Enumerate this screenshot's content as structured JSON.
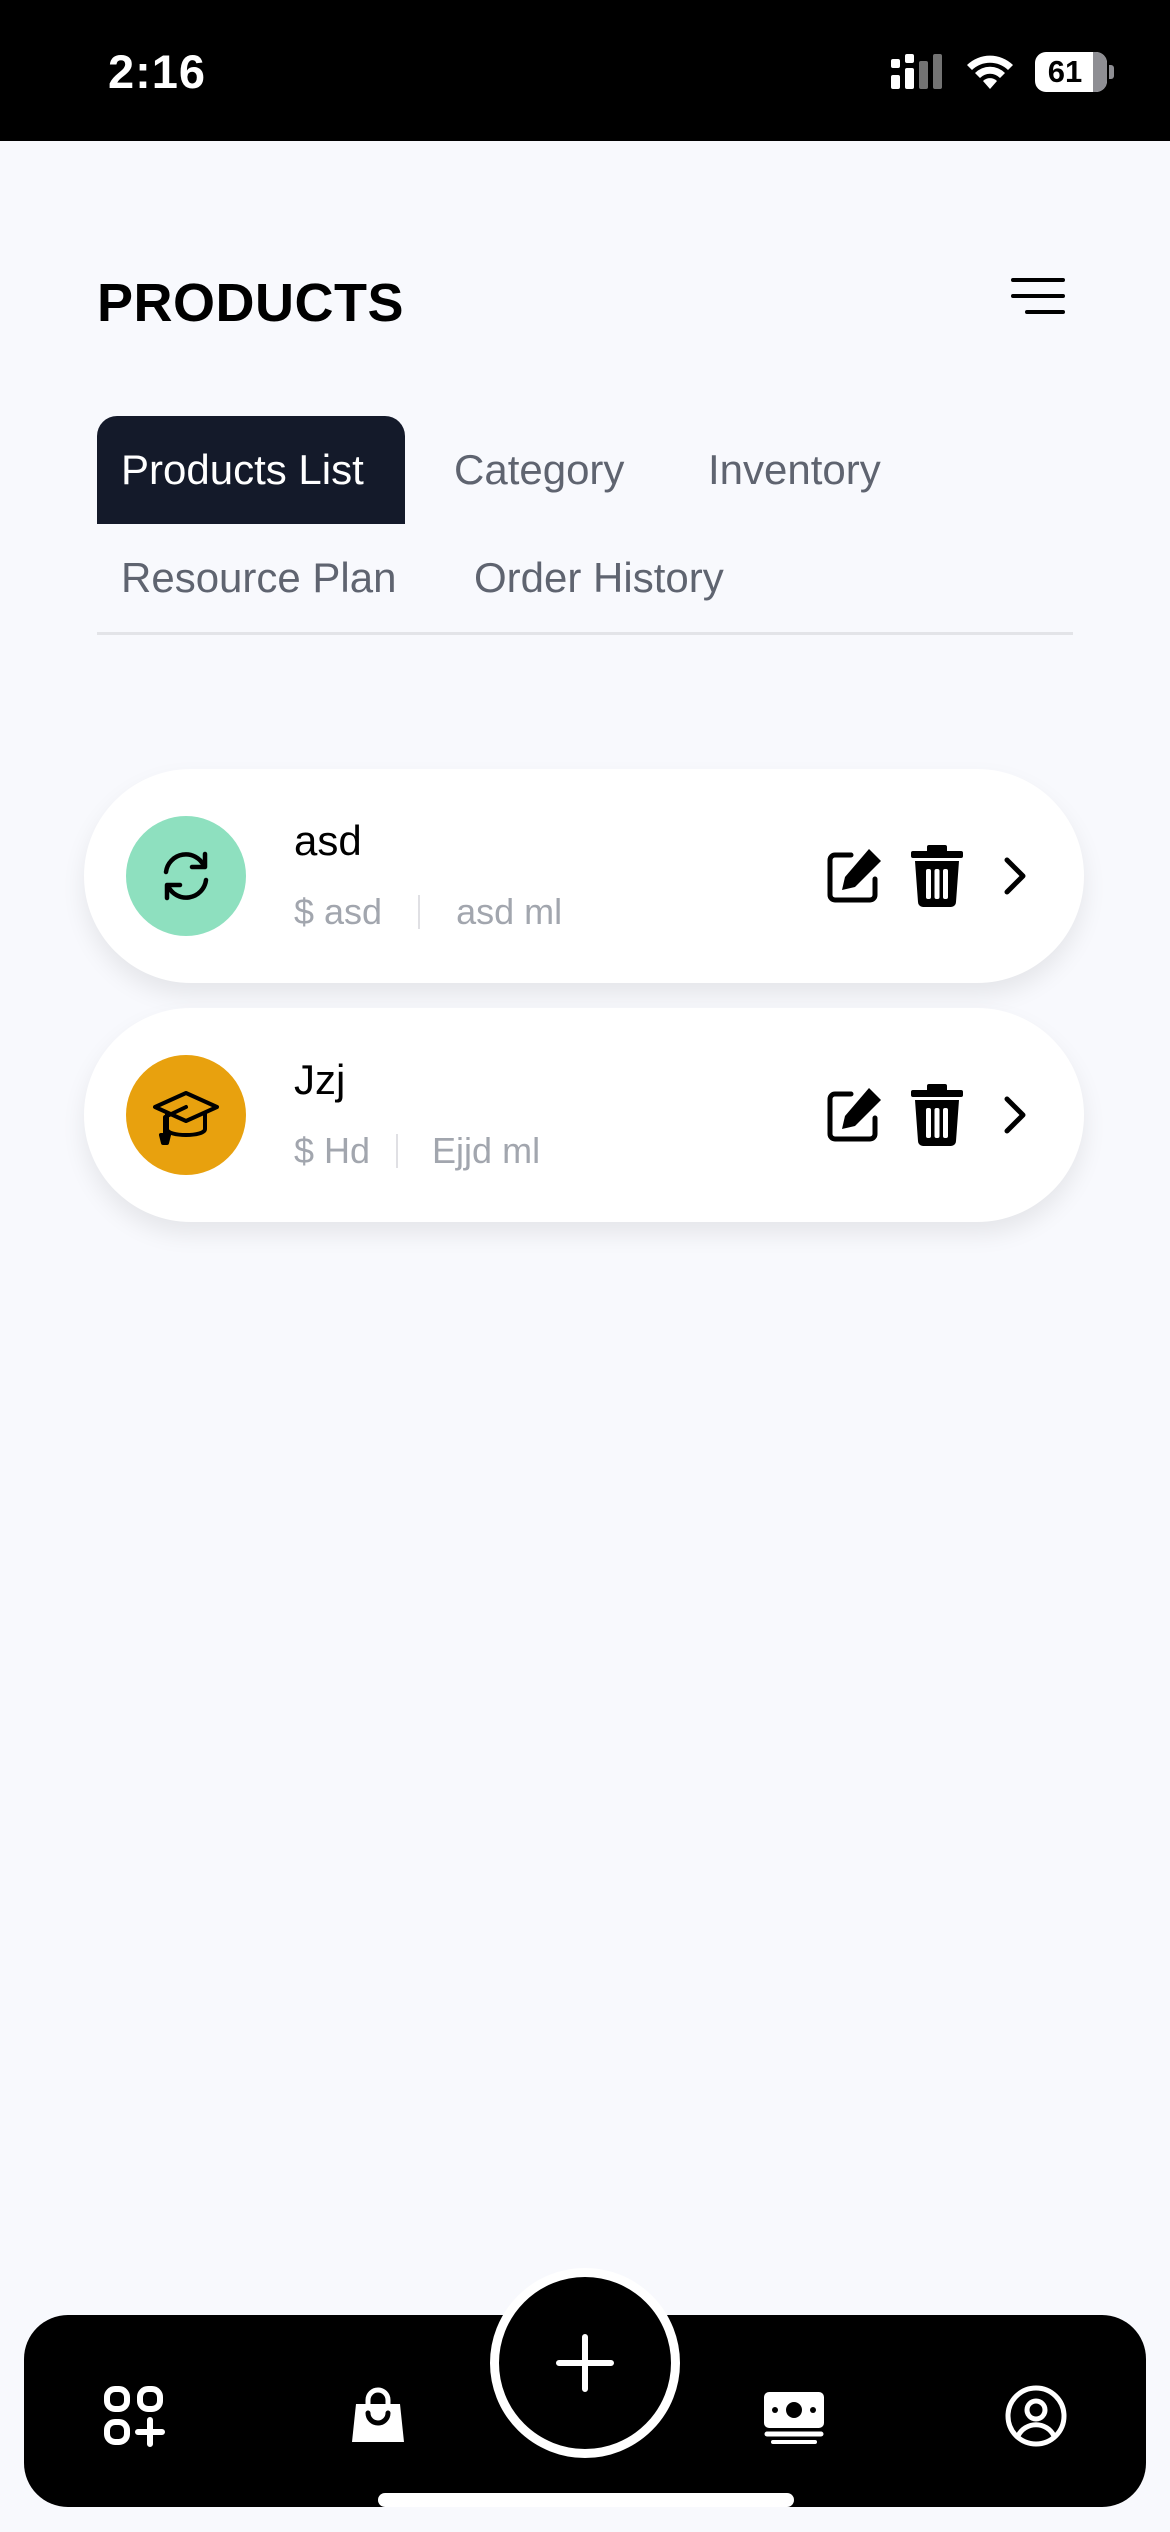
{
  "status_bar": {
    "time": "2:16",
    "battery": "61"
  },
  "header": {
    "title": "PRODUCTS"
  },
  "tabs": [
    {
      "label": "Products List",
      "active": true
    },
    {
      "label": "Category",
      "active": false
    },
    {
      "label": "Inventory",
      "active": false
    },
    {
      "label": "Resource Plan",
      "active": false
    },
    {
      "label": "Order History",
      "active": false
    }
  ],
  "products": [
    {
      "name": "asd",
      "price": "$ asd",
      "volume": "asd ml",
      "icon": "refresh-icon",
      "color": "#8ee0bf"
    },
    {
      "name": "Jzj",
      "price": "$ Hd",
      "volume": "Ejjd ml",
      "icon": "graduation-cap-icon",
      "color": "#e8a10e"
    }
  ],
  "bottom_nav": {
    "items": [
      "dashboard-icon",
      "shopping-bag-icon",
      "add-icon",
      "money-icon",
      "profile-icon"
    ]
  },
  "colors": {
    "accent_dark": "#141a2a",
    "background": "#f8f9fd"
  }
}
